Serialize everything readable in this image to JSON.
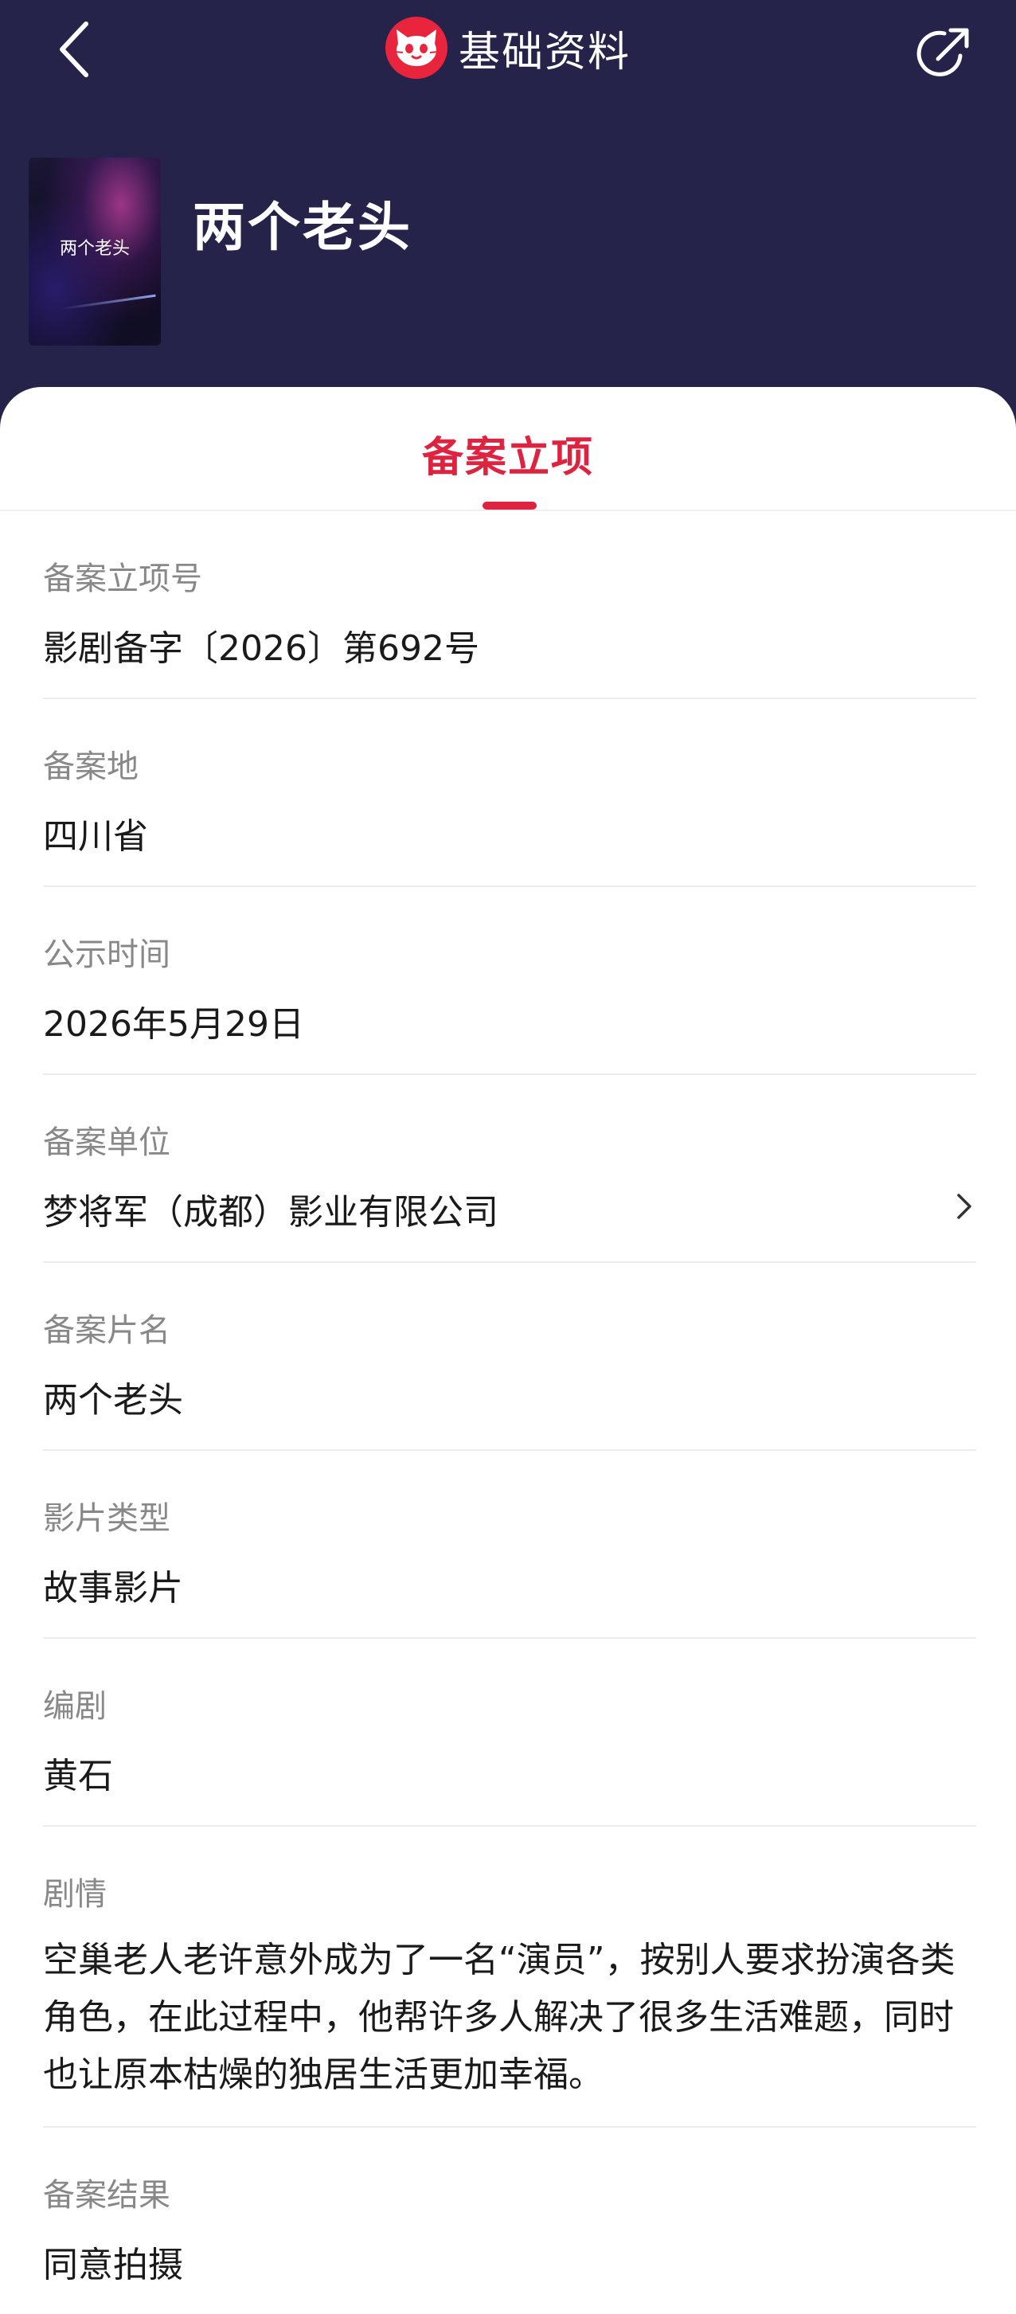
{
  "nav": {
    "title": "基础资料",
    "back_icon": "chevron-left-icon",
    "share_icon": "share-icon",
    "logo_icon": "cat-logo-icon"
  },
  "movie": {
    "title": "两个老头",
    "poster_text": "两个老头"
  },
  "tabs": [
    {
      "label": "备案立项",
      "active": true
    }
  ],
  "fields": [
    {
      "label": "备案立项号",
      "value": "影剧备字〔2026〕第692号"
    },
    {
      "label": "备案地",
      "value": "四川省"
    },
    {
      "label": "公示时间",
      "value": "2026年5月29日"
    },
    {
      "label": "备案单位",
      "value": "梦将军（成都）影业有限公司"
    },
    {
      "label": "备案片名",
      "value": "两个老头"
    },
    {
      "label": "影片类型",
      "value": "故事影片"
    },
    {
      "label": "编剧",
      "value": "黄石"
    },
    {
      "label": "剧情",
      "value": "空巢老人老许意外成为了一名“演员”，按别人要求扮演各类角色，在此过程中，他帮许多人解决了很多生活难题，同时也让原本枯燥的独居生活更加幸福。"
    },
    {
      "label": "备案结果",
      "value": "同意拍摄"
    }
  ],
  "colors": {
    "header_bg": "#25234a",
    "accent": "#dd2340",
    "logo": "#e9253e"
  }
}
